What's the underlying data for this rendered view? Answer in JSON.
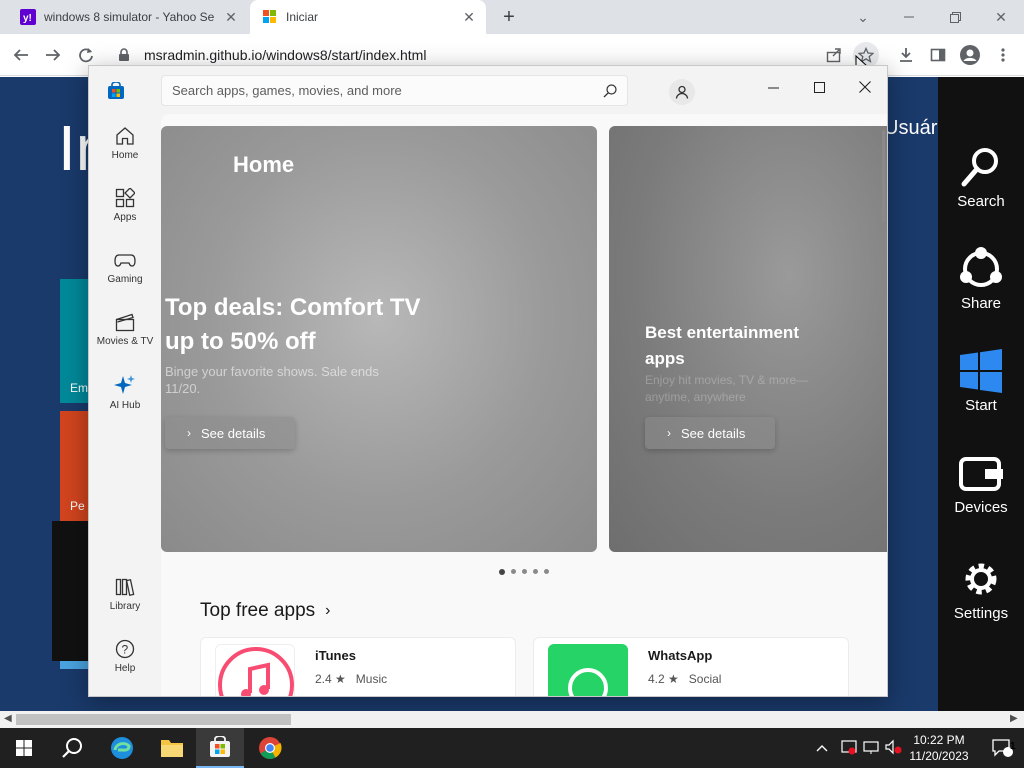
{
  "browser": {
    "tabs": [
      {
        "title": "windows 8 simulator - Yahoo Se",
        "favicon": "yahoo-favicon",
        "active": false
      },
      {
        "title": "Iniciar",
        "favicon": "windows-favicon",
        "active": true
      }
    ],
    "url": "msradmin.github.io/windows8/start/index.html"
  },
  "win8": {
    "start_title": "In",
    "user_label": "Usuár",
    "tile_labels": [
      "Em",
      "Pe"
    ],
    "charms": [
      "Search",
      "Share",
      "Start",
      "Devices",
      "Settings"
    ]
  },
  "store": {
    "search_placeholder": "Search apps, games, movies, and more",
    "nav": [
      {
        "label": "Home",
        "icon": "home-icon"
      },
      {
        "label": "Apps",
        "icon": "apps-icon"
      },
      {
        "label": "Gaming",
        "icon": "gamepad-icon"
      },
      {
        "label": "Movies & TV",
        "icon": "clapperboard-icon"
      },
      {
        "label": "AI Hub",
        "icon": "sparkle-icon"
      }
    ],
    "nav_bottom": [
      {
        "label": "Library",
        "icon": "library-icon"
      },
      {
        "label": "Help",
        "icon": "help-icon"
      }
    ],
    "home_title": "Home",
    "hero1": {
      "heading_line1": "Top deals: Comfort TV",
      "heading_line2": "up to 50% off",
      "sub_line1": "Binge your favorite shows. Sale ends",
      "sub_line2": "11/20.",
      "button": "See details"
    },
    "hero2": {
      "heading_line1": "Best entertainment",
      "heading_line2": "apps",
      "sub_line1": "Enjoy hit movies, TV & more—",
      "sub_line2": "anytime, anywhere",
      "button": "See details"
    },
    "carousel_dots": 5,
    "section_title": "Top free apps",
    "apps": [
      {
        "name": "iTunes",
        "rating": "2.4",
        "category": "Music"
      },
      {
        "name": "WhatsApp",
        "rating": "4.2",
        "category": "Social"
      }
    ]
  },
  "taskbar": {
    "time": "10:22 PM",
    "date": "11/20/2023",
    "notification_count": "1"
  },
  "colors": {
    "win8_bg": "#1a3a6b",
    "tile_teal": "#00899a",
    "tile_red": "#d1441e",
    "whatsapp_green": "#25d366",
    "store_blue": "#0067c0"
  }
}
